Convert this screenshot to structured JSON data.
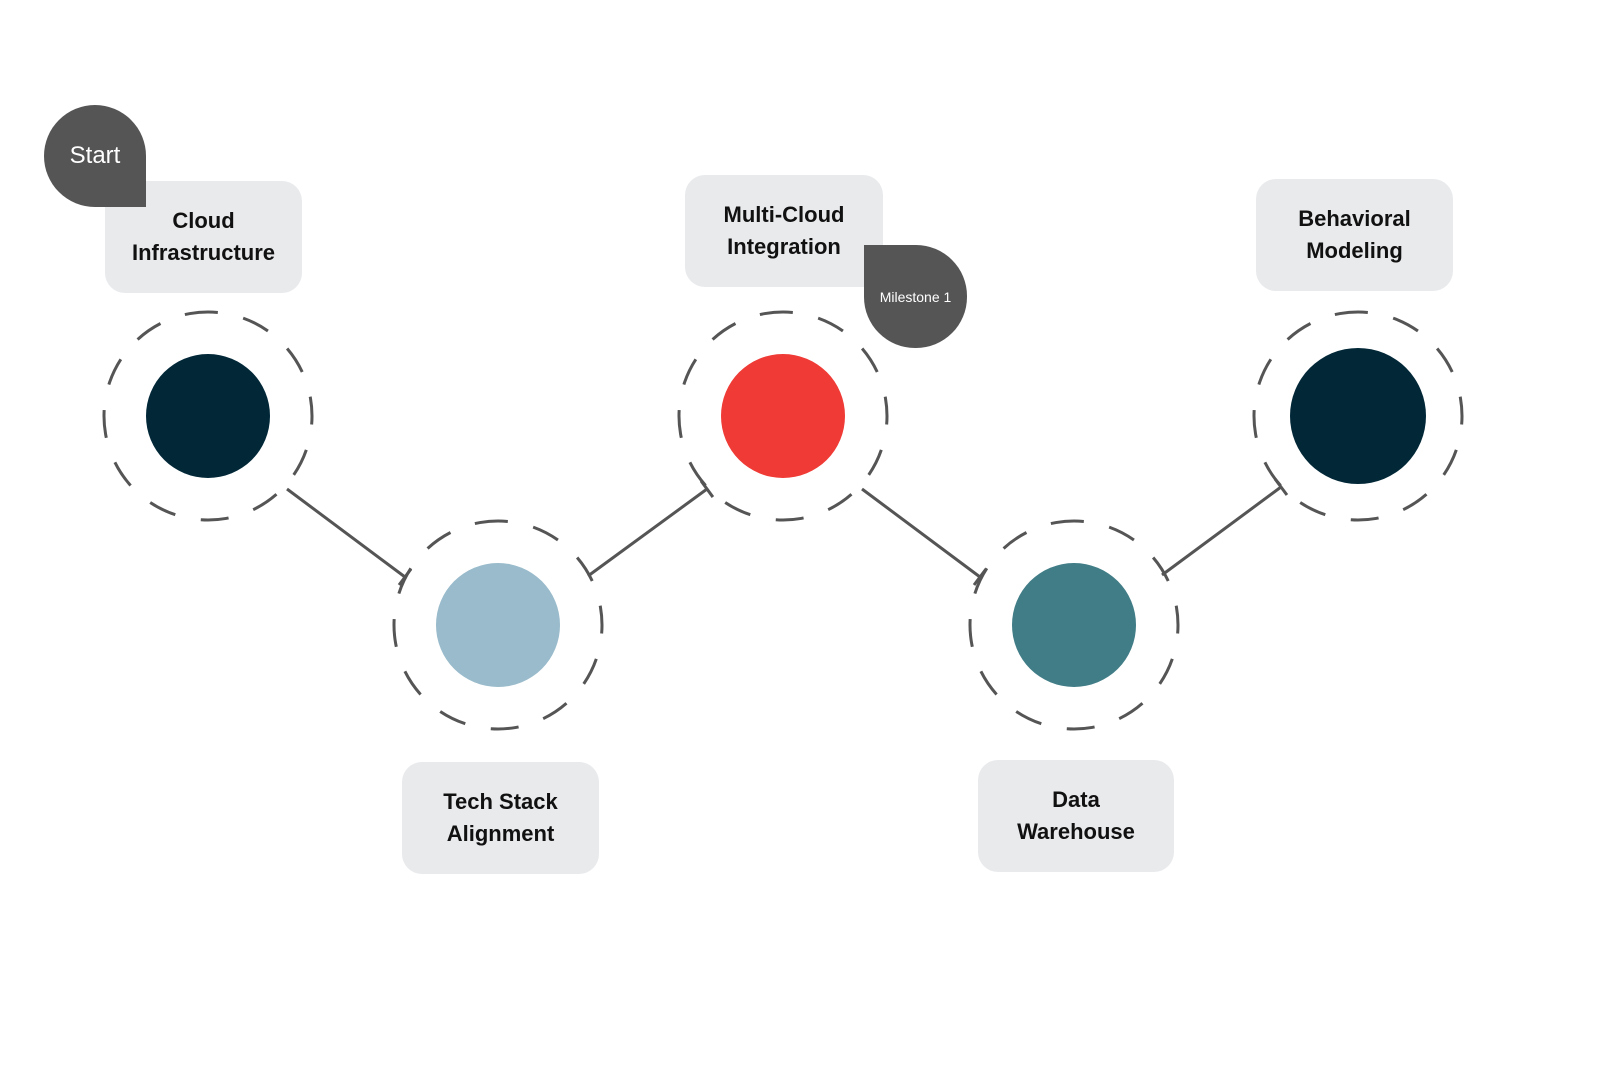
{
  "diagram": {
    "title": "",
    "start_badge": "Start",
    "milestone_badge": "Milestone 1",
    "stages": [
      {
        "label_line1": "Cloud",
        "label_line2": "Infrastructure",
        "color": "#022838",
        "position": "top"
      },
      {
        "label_line1": "Tech Stack",
        "label_line2": "Alignment",
        "color": "#99bbcb",
        "position": "bottom"
      },
      {
        "label_line1": "Multi-Cloud",
        "label_line2": "Integration",
        "color": "#ef3a35",
        "position": "top"
      },
      {
        "label_line1": "Data",
        "label_line2": "Warehouse",
        "color": "#417d87",
        "position": "bottom"
      },
      {
        "label_line1": "Behavioral",
        "label_line2": "Modeling",
        "color": "#022838",
        "position": "top"
      }
    ],
    "connector_color": "#555555",
    "label_bg": "#e9eaec"
  }
}
